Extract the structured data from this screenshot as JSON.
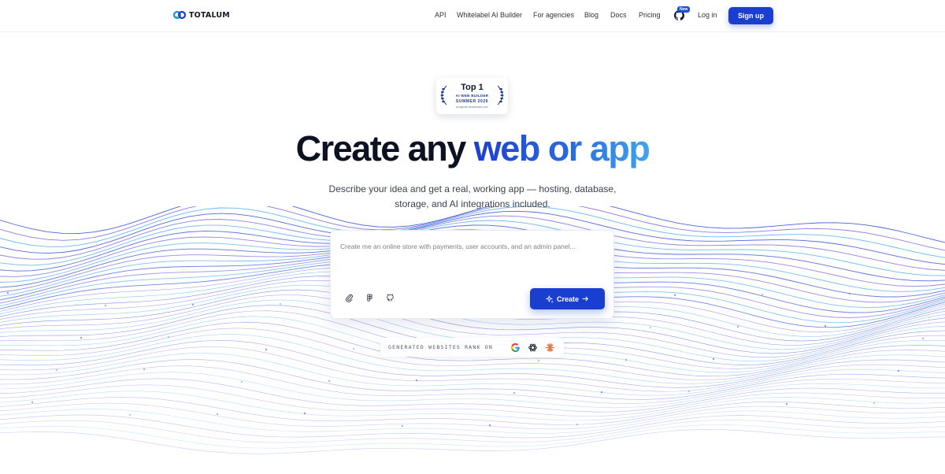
{
  "brand": {
    "name": "TOTALUM"
  },
  "nav": {
    "items": [
      {
        "label": "API"
      },
      {
        "label": "Whitelabel AI Builder"
      },
      {
        "label": "For agencies"
      },
      {
        "label": "Blog"
      },
      {
        "label": "Docs"
      },
      {
        "label": "Pricing"
      }
    ],
    "github_badge": "New",
    "login": "Log in",
    "signup": "Sign up"
  },
  "award": {
    "top": "Top 1",
    "line2": "AI WEB BUILDER",
    "line3": "SUMMER 2026",
    "line4": "ai-agents-benchmark.com"
  },
  "hero": {
    "headline_plain": "Create any ",
    "headline_accent": "web or app",
    "subtitle_line1": "Describe your idea and get a real, working app — hosting, database,",
    "subtitle_line2": "storage, and AI integrations included."
  },
  "prompt": {
    "placeholder": "Create me an online store with payments, user accounts, and an admin panel...",
    "tools": [
      "paperclip-icon",
      "figma-icon",
      "github-icon"
    ],
    "create_label": "Create"
  },
  "rank": {
    "label": "GENERATED WEBSITES RANK ON",
    "engines": [
      "google-icon",
      "openai-icon",
      "claude-icon"
    ]
  },
  "colors": {
    "accent": "#1a3ed0",
    "headline_gradient": [
      "#1d3fcf",
      "#3ea5ec"
    ],
    "wave_colors": [
      "#1e3fcf",
      "#6a5adc",
      "#3ea5ec"
    ]
  }
}
